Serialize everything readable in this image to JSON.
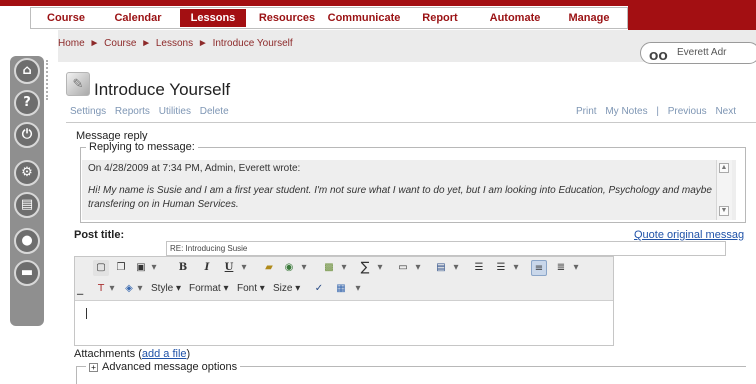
{
  "nav": {
    "items": [
      {
        "label": "Course",
        "active": false
      },
      {
        "label": "Calendar",
        "active": false
      },
      {
        "label": "Lessons",
        "active": true
      },
      {
        "label": "Resources",
        "active": false
      },
      {
        "label": "Communicate",
        "active": false
      },
      {
        "label": "Report",
        "active": false
      },
      {
        "label": "Automate",
        "active": false
      },
      {
        "label": "Manage",
        "active": false
      }
    ],
    "brand_color": "#a30f12"
  },
  "breadcrumb": {
    "items": [
      "Home",
      "Course",
      "Lessons",
      "Introduce Yourself"
    ],
    "separator": "►"
  },
  "user": {
    "name": "Everett Adr"
  },
  "page": {
    "title": "Introduce Yourself"
  },
  "subnav": {
    "left": [
      "Settings",
      "Reports",
      "Utilities",
      "Delete"
    ],
    "right": [
      "Print",
      "My Notes",
      "|",
      "Previous",
      "Next"
    ]
  },
  "message": {
    "section_label": "Message reply",
    "legend": "Replying to message:",
    "quote_header": "On 4/28/2009 at 7:34 PM, Admin, Everett wrote:",
    "quote_body": "Hi!  My name is Susie and I am a first year student.  I'm not sure what I want to do yet, but I am looking into Education, Psychology and maybe transfering on in Human Services."
  },
  "post": {
    "title_label": "Post title:",
    "title_value": "RE: Introducing Susie",
    "quote_link": "Quote original messag"
  },
  "toolbar": {
    "style_label": "Style",
    "format_label": "Format",
    "font_label": "Font",
    "size_label": "Size",
    "bold": "B",
    "italic": "I",
    "underline": "U",
    "sigma": "∑"
  },
  "attachments": {
    "label": "Attachments (",
    "link": "add a file",
    "close": ")"
  },
  "advanced": {
    "label": "Advanced message options"
  }
}
